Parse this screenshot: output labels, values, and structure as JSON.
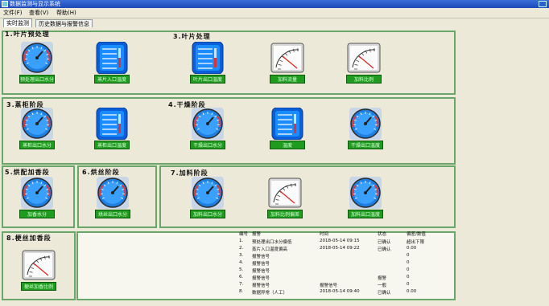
{
  "window": {
    "title": "数据监测与显示系统"
  },
  "menu": {
    "items": [
      "文件(F)",
      "查看(V)",
      "帮助(H)"
    ]
  },
  "tabs": [
    "实时监测",
    "历史数据与报警信息"
  ],
  "panels": [
    {
      "title": "1.叶片预处理"
    },
    {
      "title": "3.叶片处理"
    },
    {
      "title": "3.蒸柜阶段"
    },
    {
      "title": "4.干燥阶段"
    },
    {
      "title": "5.烘配加香段"
    },
    {
      "title": "6.烘丝阶段"
    },
    {
      "title": "7.加料阶段"
    },
    {
      "title": "8.梗丝加香段"
    }
  ],
  "gauges": [
    {
      "label": "预处理出口水分",
      "kind": "dial"
    },
    {
      "label": "蒸片入口温度",
      "kind": "digital"
    },
    {
      "label": "叶片出口温度",
      "kind": "digital"
    },
    {
      "label": "加料流量",
      "kind": "meter"
    },
    {
      "label": "加料比例",
      "kind": "meter"
    },
    {
      "label": "蒸柜出口水分",
      "kind": "dial"
    },
    {
      "label": "蒸柜出口温度",
      "kind": "digital"
    },
    {
      "label": "干燥出口水分",
      "kind": "dial"
    },
    {
      "label": "温度",
      "kind": "digital"
    },
    {
      "label": "干燥出口温度",
      "kind": "dial"
    },
    {
      "label": "加香水分",
      "kind": "dial"
    },
    {
      "label": "烘丝出口水分",
      "kind": "dial"
    },
    {
      "label": "加料出口水分",
      "kind": "dial"
    },
    {
      "label": "加料比例偏差",
      "kind": "meter"
    },
    {
      "label": "加料出口温度",
      "kind": "dial"
    },
    {
      "label": "梗丝加香比例",
      "kind": "meter"
    }
  ],
  "alarm_table": {
    "headers": [
      "编号",
      "报警",
      "时间",
      "状态",
      "偏差/数值"
    ],
    "rows": [
      [
        "1.",
        "预处理出口水分偏低",
        "2018-05-14 09:15",
        "已确认",
        "超出下限"
      ],
      [
        "2.",
        "蒸片入口温度偏高",
        "2018-05-14 09:22",
        "已确认",
        "0.00"
      ],
      [
        "3.",
        "报警信号",
        "",
        "",
        "0"
      ],
      [
        "4.",
        "报警信号",
        "",
        "",
        "0"
      ],
      [
        "5.",
        "报警信号",
        "",
        "",
        "0"
      ],
      [
        "6.",
        "报警信号",
        "",
        "报警",
        "0"
      ],
      [
        "7.",
        "报警信号",
        "报警信号",
        "一般",
        "0"
      ],
      [
        "8.",
        "数据异常（人工）",
        "2018-05-14 09:40",
        "已确认",
        "0.00"
      ]
    ]
  }
}
